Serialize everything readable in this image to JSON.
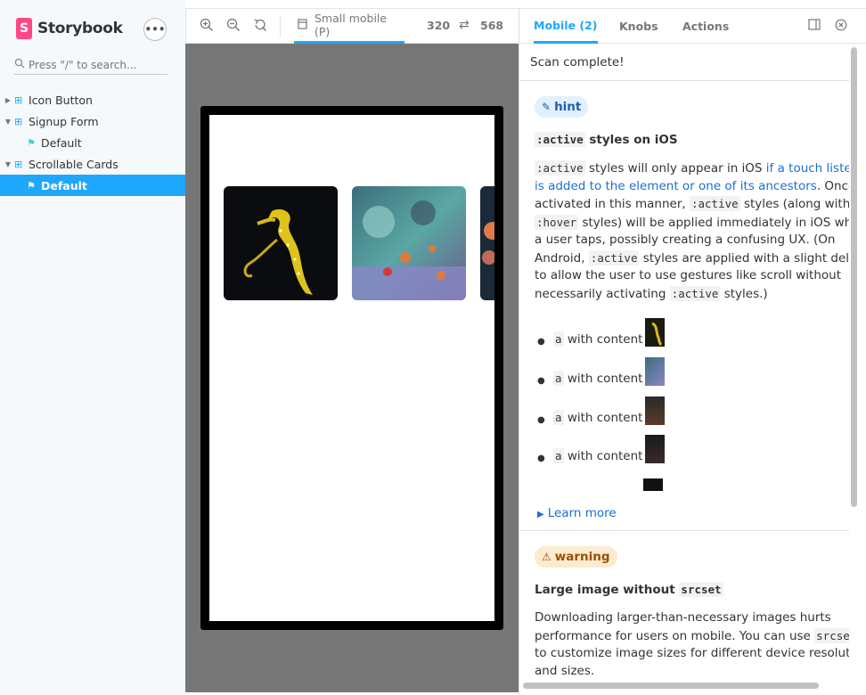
{
  "sidebar": {
    "logo_letter": "S",
    "logo_text": "Storybook",
    "menu_label": "•••",
    "search_placeholder": "Press \"/\" to search...",
    "items": [
      {
        "label": "Icon Button"
      },
      {
        "label": "Signup Form"
      },
      {
        "label": "Default"
      },
      {
        "label": "Scrollable Cards"
      },
      {
        "label": "Default"
      }
    ]
  },
  "toolbar": {
    "viewport_label": "Small mobile (P)",
    "width": "320",
    "height": "568"
  },
  "panel": {
    "tabs": [
      "Mobile (2)",
      "Knobs",
      "Actions"
    ],
    "scan_status": "Scan complete!",
    "hint": {
      "badge": "hint",
      "title_code": ":active",
      "title_rest": "styles on iOS",
      "p1_code": ":active",
      "p1_text": "styles will only appear in iOS",
      "p1_link": "if a touch listen",
      "p2_link": "is added to the element or one of its ancestors",
      "p2_text": ". Once",
      "p3_a": "activated in this manner,",
      "p3_code": ":active",
      "p3_b": "styles (along with",
      "p4_code": ":hover",
      "p4_text": "styles) will be applied immediately in iOS whe",
      "p5": "a user taps, possibly creating a confusing UX. (On",
      "p6_a": "Android,",
      "p6_code": ":active",
      "p6_b": "styles are applied with a slight dela",
      "p7": "to allow the user to use gestures like scroll without",
      "p8_a": "necessarily activating",
      "p8_code": ":active",
      "p8_b": "styles.)",
      "list": [
        {
          "code": "a",
          "text": "with content"
        },
        {
          "code": "a",
          "text": "with content"
        },
        {
          "code": "a",
          "text": "with content"
        },
        {
          "code": "a",
          "text": "with content"
        }
      ],
      "learn_more": "Learn more"
    },
    "warning": {
      "badge": "warning",
      "title_text": "Large image without",
      "title_code": "srcset",
      "p1": "Downloading larger-than-necessary images hurts",
      "p2_a": "performance for users on mobile. You can use",
      "p2_code": "srcset",
      "p3": "to customize image sizes for different device resolutio",
      "p4": "and sizes."
    }
  },
  "colors": {
    "accent": "#1ea7fd",
    "brand": "#ff4785",
    "canvas": "#767676"
  }
}
